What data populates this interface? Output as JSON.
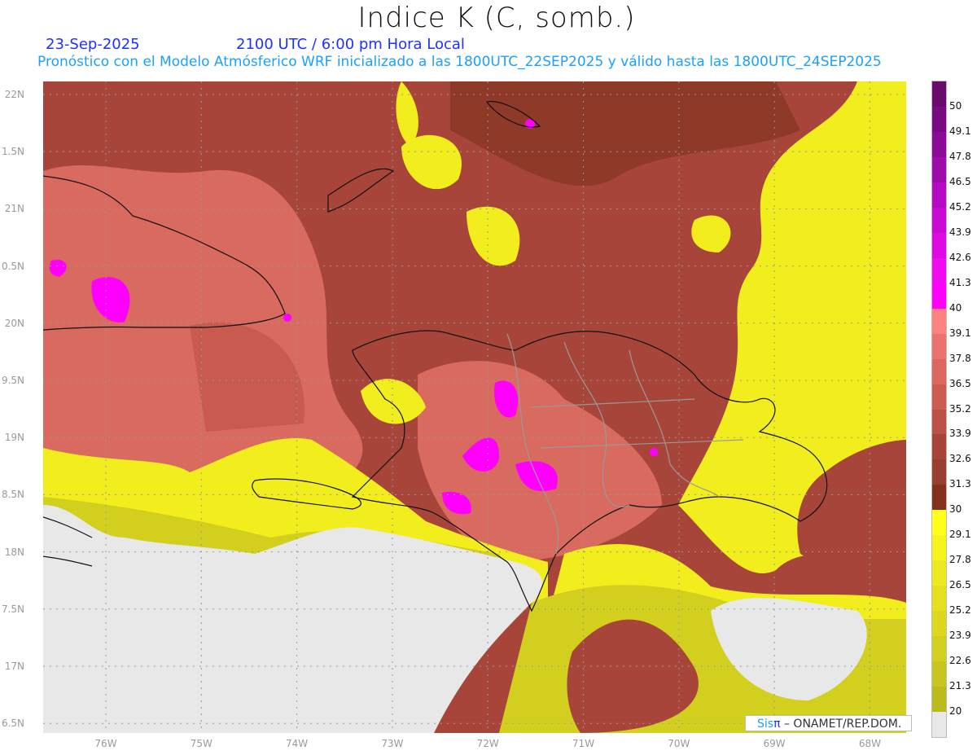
{
  "header": {
    "title": "Indice K (C, somb.)",
    "date": "23-Sep-2025",
    "time": "2100 UTC / 6:00 pm Hora Local",
    "subtitle": "Pronóstico con el Modelo Atmósferico WRF inicializado a las 1800UTC_22SEP2025 y válido hasta las  1800UTC_24SEP2025"
  },
  "axes": {
    "lat_labels": [
      "22N",
      "1.5N",
      "21N",
      "0.5N",
      "20N",
      "9.5N",
      "19N",
      "8.5N",
      "18N",
      "7.5N",
      "17N",
      "6.5N"
    ],
    "lon_labels": [
      "76W",
      "75W",
      "74W",
      "73W",
      "72W",
      "71W",
      "70W",
      "69W",
      "68W"
    ]
  },
  "colorbar": {
    "labels": [
      "50",
      "49.1",
      "47.8",
      "46.5",
      "45.2",
      "43.9",
      "42.6",
      "41.3",
      "40",
      "39.1",
      "37.8",
      "36.5",
      "35.2",
      "33.9",
      "32.6",
      "31.3",
      "30",
      "29.1",
      "27.8",
      "26.5",
      "25.2",
      "23.9",
      "22.6",
      "21.3",
      "20"
    ],
    "colors": [
      "#6a0a6c",
      "#7a0a82",
      "#8c0a98",
      "#9e0aac",
      "#b40ac2",
      "#ca0ad4",
      "#de0ae4",
      "#f00af2",
      "#ff00ff",
      "#ff8080",
      "#ec7270",
      "#de6660",
      "#cc5c52",
      "#ba5046",
      "#a8453a",
      "#983f30",
      "#85301c",
      "#ffff1e",
      "#f5f41e",
      "#ece91e",
      "#e4e01e",
      "#dcd81e",
      "#d3cf1e",
      "#c8c61e",
      "#bcbb1e",
      "#e8e8e8"
    ]
  },
  "credit": {
    "brand_sis": "Sis",
    "brand_pi": "π",
    "agency": "– ONAMET/REP.DOM."
  }
}
